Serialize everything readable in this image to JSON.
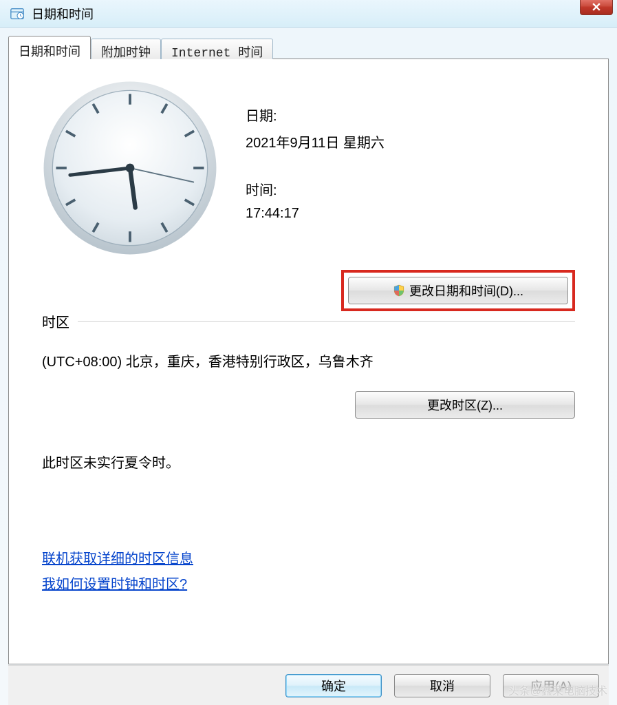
{
  "window": {
    "title": "日期和时间"
  },
  "tabs": {
    "datetime": "日期和时间",
    "additional": "附加时钟",
    "internet": "Internet 时间"
  },
  "date_section": {
    "label": "日期:",
    "value": "2021年9月11日 星期六"
  },
  "time_section": {
    "label": "时间:",
    "value": "17:44:17"
  },
  "buttons": {
    "change_datetime": "更改日期和时间(D)...",
    "change_timezone": "更改时区(Z)..."
  },
  "timezone": {
    "header": "时区",
    "value": "(UTC+08:00) 北京，重庆，香港特别行政区，乌鲁木齐",
    "dst_note": "此时区未实行夏令时。"
  },
  "links": {
    "online_info": "联机获取详细的时区信息",
    "how_to": "我如何设置时钟和时区?"
  },
  "dialog_buttons": {
    "ok": "确定",
    "cancel": "取消",
    "apply": "应用(A)"
  },
  "watermark": "头条@鑫荣电脑技术",
  "clock": {
    "hour": 17,
    "minute": 44,
    "second": 17
  }
}
